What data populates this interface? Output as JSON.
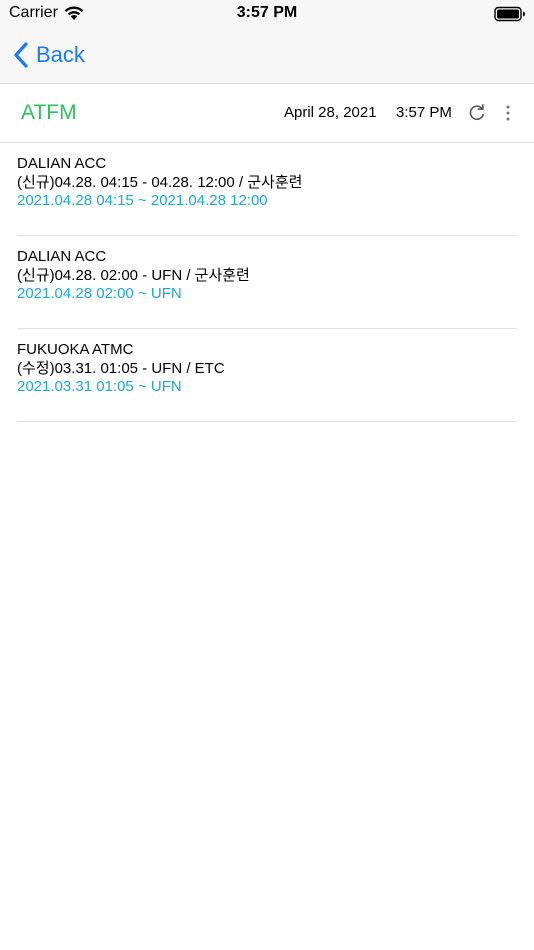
{
  "status_bar": {
    "carrier": "Carrier",
    "time": "3:57 PM",
    "wifi_icon": "wifi-icon",
    "battery_icon": "battery-icon"
  },
  "nav": {
    "back_label": "Back",
    "back_icon": "chevron-left-icon"
  },
  "header": {
    "title": "ATFM",
    "date": "April 28, 2021",
    "time": "3:57 PM",
    "refresh_icon": "refresh-icon",
    "more_icon": "more-vertical-icon"
  },
  "colors": {
    "accent_blue": "#1a7cf5",
    "title_green": "#2ec05a",
    "period_blue": "#1aa7e0"
  },
  "items": [
    {
      "unit": "DALIAN ACC",
      "summary": "(신규)04.28. 04:15 - 04.28. 12:00 / 군사훈련",
      "period": "2021.04.28 04:15 ~ 2021.04.28 12:00"
    },
    {
      "unit": "DALIAN ACC",
      "summary": "(신규)04.28. 02:00 - UFN / 군사훈련",
      "period": "2021.04.28 02:00 ~ UFN"
    },
    {
      "unit": "FUKUOKA ATMC",
      "summary": "(수정)03.31. 01:05 - UFN / ETC",
      "period": "2021.03.31 01:05 ~ UFN"
    }
  ]
}
